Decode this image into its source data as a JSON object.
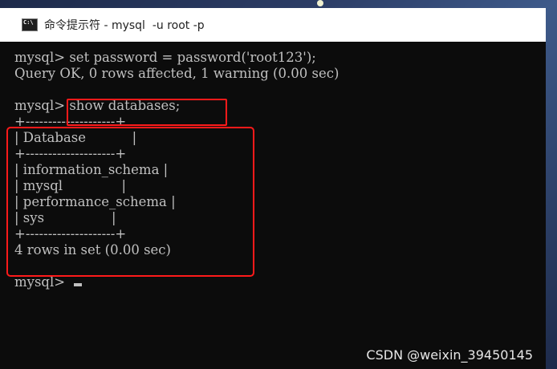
{
  "window": {
    "title": "命令提示符 - mysql  -u root -p",
    "icon": "cmd-icon"
  },
  "console": {
    "lines": [
      "mysql> set password = password('root123');",
      "Query OK, 0 rows affected, 1 warning (0.00 sec)",
      "",
      "mysql> show databases;",
      "+--------------------+",
      "| Database           |",
      "+--------------------+",
      "| information_schema |",
      "| mysql              |",
      "| performance_schema |",
      "| sys                |",
      "+--------------------+",
      "4 rows in set (0.00 sec)",
      "",
      "mysql> "
    ]
  },
  "colors": {
    "console_text": "#c0c0c0",
    "console_bg": "#0c0c0c",
    "highlight_box": "#ff1a1a"
  },
  "watermark": {
    "text": "CSDN @weixin_39450145"
  }
}
